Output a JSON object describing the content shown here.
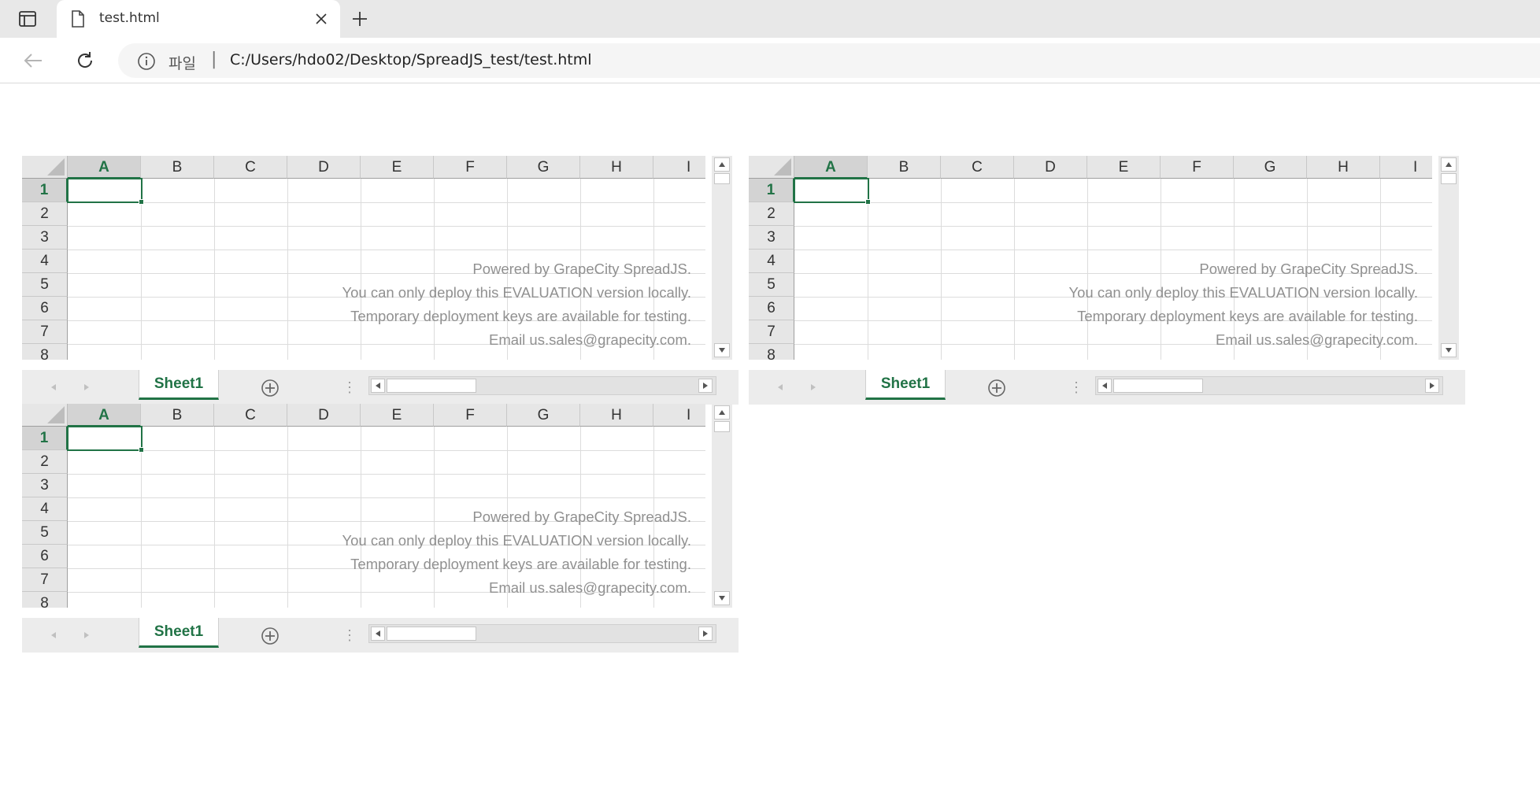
{
  "browser": {
    "tab_title": "test.html",
    "scheme_label": "파일",
    "separator": "|",
    "url": "C:/Users/hdo02/Desktop/SpreadJS_test/test.html"
  },
  "spreadsheet": {
    "columns": [
      "A",
      "B",
      "C",
      "D",
      "E",
      "F",
      "G",
      "H",
      "I"
    ],
    "rows": [
      "1",
      "2",
      "3",
      "4",
      "5",
      "6",
      "7",
      "8"
    ],
    "active_cell": "A1",
    "sheet_tab": "Sheet1",
    "watermark": [
      "Powered by GrapeCity SpreadJS.",
      "You can only deploy this EVALUATION version locally.",
      "Temporary deployment keys are available for testing.",
      "Email us.sales@grapecity.com."
    ],
    "tab_menu_glyph": "⋮"
  },
  "icons": {
    "sidebar": "sidebar-toggle-icon",
    "file": "file-icon",
    "close": "close-icon",
    "new_tab": "plus-icon",
    "back": "arrow-left-icon",
    "reload": "reload-icon",
    "info": "info-icon",
    "add_sheet": "circle-plus-icon"
  }
}
